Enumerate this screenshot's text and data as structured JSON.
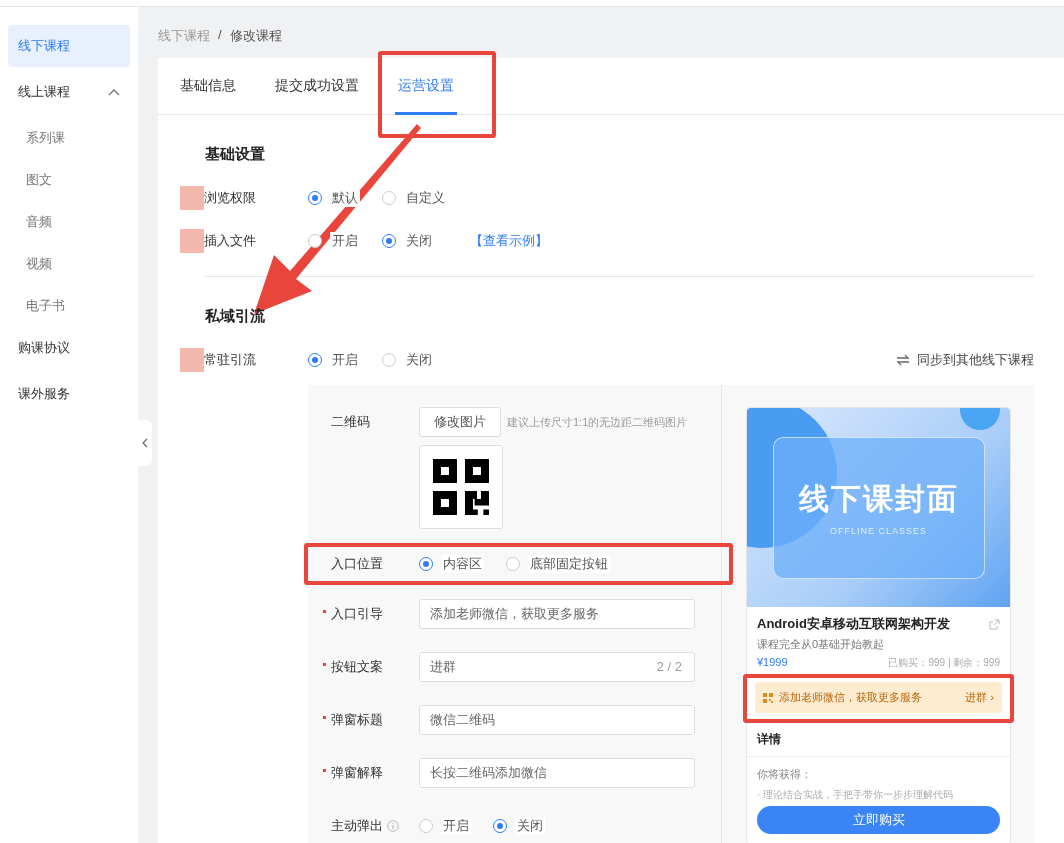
{
  "sidebar": {
    "items": [
      {
        "label": "线下课程",
        "selected": true
      },
      {
        "label": "线上课程",
        "selected": false,
        "expanded": true,
        "children": [
          {
            "label": "系列课",
            "selected": false
          },
          {
            "label": "图文",
            "selected": false
          },
          {
            "label": "音频",
            "selected": false
          },
          {
            "label": "视频",
            "selected": false
          },
          {
            "label": "电子书",
            "selected": false
          }
        ]
      },
      {
        "label": "购课协议",
        "selected": false
      },
      {
        "label": "课外服务",
        "selected": false
      }
    ]
  },
  "breadcrumb": {
    "items": [
      "线下课程",
      "修改课程"
    ],
    "separator": "/"
  },
  "tabs": [
    {
      "label": "基础信息",
      "selected": false,
      "highlighted": false
    },
    {
      "label": "提交成功设置",
      "selected": false,
      "highlighted": false
    },
    {
      "label": "运营设置",
      "selected": true,
      "highlighted": true
    }
  ],
  "sections": [
    {
      "title": "基础设置",
      "pointed_at": false,
      "rows": [
        {
          "label": "浏览权限",
          "redacted": true,
          "options": [
            {
              "label": "默认",
              "selected": true
            },
            {
              "label": "自定义",
              "selected": false
            }
          ]
        },
        {
          "label": "插入文件",
          "redacted": true,
          "options": [
            {
              "label": "开启",
              "selected": false
            },
            {
              "label": "关闭",
              "selected": true
            }
          ],
          "link": "【查看示例】"
        }
      ]
    },
    {
      "title": "私域引流",
      "pointed_at": true,
      "rows": [
        {
          "label": "常驻引流",
          "redacted": true,
          "options": [
            {
              "label": "开启",
              "selected": true
            },
            {
              "label": "关闭",
              "selected": false
            }
          ],
          "sync_link": "同步到其他线下课程"
        }
      ]
    }
  ],
  "drainage_panel": {
    "qr": {
      "label": "二维码",
      "button": "修改图片",
      "hint": "建议上传尺寸1:1的无边距二维码图片"
    },
    "entry_position": {
      "label": "入口位置",
      "highlighted": true,
      "options": [
        {
          "label": "内容区",
          "selected": true
        },
        {
          "label": "底部固定按钮",
          "selected": false
        }
      ]
    },
    "fields": [
      {
        "label": "入口引导",
        "required": true,
        "value": "添加老师微信，获取更多服务"
      },
      {
        "label": "按钮文案",
        "required": true,
        "value": "进群",
        "counter": "2 / 2"
      },
      {
        "label": "弹窗标题",
        "required": true,
        "value": "微信二维码"
      },
      {
        "label": "弹窗解释",
        "required": true,
        "value": "长按二维码添加微信"
      }
    ],
    "popup": {
      "label": "主动弹出",
      "options": [
        {
          "label": "开启",
          "selected": false
        },
        {
          "label": "关闭",
          "selected": true
        }
      ]
    }
  },
  "preview": {
    "cover_title": "线下课封面",
    "cover_subtitle": "OFFLINE CLASSES",
    "course_title": "Android安卓移动互联网架构开发",
    "course_desc": "课程完全从0基础开始教起",
    "price": "¥1999",
    "stats": "已购买：999 | 剩余：999",
    "banner": {
      "text": "添加老师微信，获取更多服务",
      "action": "进群 ›",
      "highlighted": true
    },
    "details_heading": "详情",
    "gain_heading": "你将获得：",
    "gain_items": [
      "· 理论结合实战，手把手带你一步步理解代码"
    ],
    "buy_button": "立即购买"
  }
}
